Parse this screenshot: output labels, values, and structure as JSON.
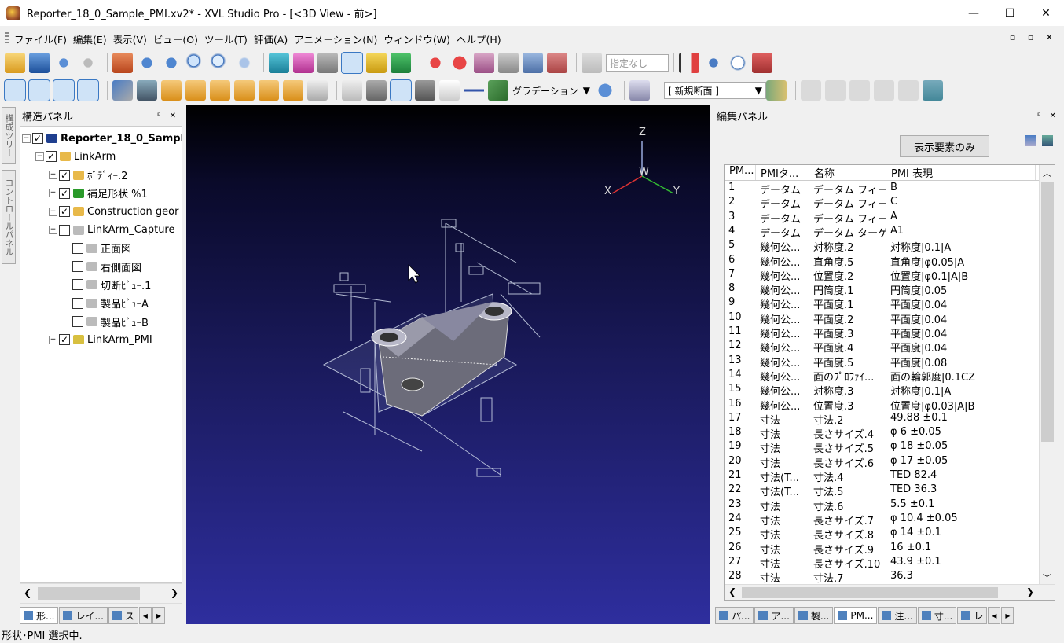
{
  "window": {
    "title": "Reporter_18_0_Sample_PMI.xv2* - XVL Studio Pro - [<3D View - 前>]",
    "minimize": "—",
    "maximize": "☐",
    "close": "✕"
  },
  "menu": [
    "ファイル(F)",
    "編集(E)",
    "表示(V)",
    "ビュー(O)",
    "ツール(T)",
    "評価(A)",
    "アニメーション(N)",
    "ウィンドウ(W)",
    "ヘルプ(H)"
  ],
  "mdi_controls": "▫ ▫ ✕",
  "toolbar": {
    "specify_dropdown": "指定なし",
    "gradation_label": "グラデーション",
    "section_dropdown": "[ 新規断面 ]"
  },
  "structure_panel": {
    "title": "構造パネル",
    "pin": "ᵖ ✕",
    "side_tabs": [
      "構成ツリー",
      "コントロールパネル"
    ],
    "tree": [
      {
        "label": "Reporter_18_0_Sample",
        "level": 0,
        "checked": true,
        "expander": "−",
        "bold": true
      },
      {
        "label": "LinkArm",
        "level": 1,
        "checked": true,
        "expander": "−"
      },
      {
        "label": "ﾎﾞﾃﾞｨｰ.2",
        "level": 2,
        "checked": true,
        "expander": "+"
      },
      {
        "label": "補足形状 %1",
        "level": 2,
        "checked": true,
        "expander": "+"
      },
      {
        "label": "Construction geor",
        "level": 2,
        "checked": true,
        "expander": "+"
      },
      {
        "label": "LinkArm_Capture",
        "level": 2,
        "checked": false,
        "expander": "−"
      },
      {
        "label": "正面図",
        "level": 3,
        "checked": false,
        "expander": ""
      },
      {
        "label": "右側面図",
        "level": 3,
        "checked": false,
        "expander": ""
      },
      {
        "label": "切断ﾋﾞｭｰ.1",
        "level": 3,
        "checked": false,
        "expander": ""
      },
      {
        "label": "製品ﾋﾞｭｰA",
        "level": 3,
        "checked": false,
        "expander": ""
      },
      {
        "label": "製品ﾋﾞｭｰB",
        "level": 3,
        "checked": false,
        "expander": ""
      },
      {
        "label": "LinkArm_PMI",
        "level": 2,
        "checked": true,
        "expander": "+"
      }
    ],
    "bottom_tabs": [
      "形...",
      "レイ...",
      "ス"
    ]
  },
  "view3d": {
    "axis_z": "Z",
    "axis_w": "W",
    "axis_x": "X",
    "axis_y": "Y"
  },
  "edit_panel": {
    "title": "編集パネル",
    "pin": "ᵖ ✕",
    "show_only_button": "表示要素のみ",
    "columns": [
      "PM...",
      "PMIタ...",
      "名称",
      "PMI 表現"
    ],
    "rows": [
      [
        "1",
        "データム",
        "データム フィーチ...",
        "B"
      ],
      [
        "2",
        "データム",
        "データム フィーチ...",
        "C"
      ],
      [
        "3",
        "データム",
        "データム フィーチ...",
        "A"
      ],
      [
        "4",
        "データム",
        "データム ターゲ...",
        "A1"
      ],
      [
        "5",
        "幾何公...",
        "対称度.2",
        "対称度|0.1|A"
      ],
      [
        "6",
        "幾何公...",
        "直角度.5",
        "直角度|φ0.05|A"
      ],
      [
        "7",
        "幾何公...",
        "位置度.2",
        "位置度|φ0.1|A|B"
      ],
      [
        "8",
        "幾何公...",
        "円筒度.1",
        "円筒度|0.05"
      ],
      [
        "9",
        "幾何公...",
        "平面度.1",
        "平面度|0.04"
      ],
      [
        "10",
        "幾何公...",
        "平面度.2",
        "平面度|0.04"
      ],
      [
        "11",
        "幾何公...",
        "平面度.3",
        "平面度|0.04"
      ],
      [
        "12",
        "幾何公...",
        "平面度.4",
        "平面度|0.04"
      ],
      [
        "13",
        "幾何公...",
        "平面度.5",
        "平面度|0.08"
      ],
      [
        "14",
        "幾何公...",
        "面のﾌﾟﾛﾌｧｲ...",
        "面の輪郭度|0.1CZ"
      ],
      [
        "15",
        "幾何公...",
        "対称度.3",
        "対称度|0.1|A"
      ],
      [
        "16",
        "幾何公...",
        "位置度.3",
        "位置度|φ0.03|A|B"
      ],
      [
        "17",
        "寸法",
        "寸法.2",
        "49.88 ±0.1"
      ],
      [
        "18",
        "寸法",
        "長さサイズ.4",
        "φ 6 ±0.05"
      ],
      [
        "19",
        "寸法",
        "長さサイズ.5",
        "φ 18 ±0.05"
      ],
      [
        "20",
        "寸法",
        "長さサイズ.6",
        "φ 17 ±0.05"
      ],
      [
        "21",
        "寸法(T...",
        "寸法.4",
        "TED 82.4"
      ],
      [
        "22",
        "寸法(T...",
        "寸法.5",
        "TED 36.3"
      ],
      [
        "23",
        "寸法",
        "寸法.6",
        "5.5 ±0.1"
      ],
      [
        "24",
        "寸法",
        "長さサイズ.7",
        "φ 10.4 ±0.05"
      ],
      [
        "25",
        "寸法",
        "長さサイズ.8",
        "φ 14 ±0.1"
      ],
      [
        "26",
        "寸法",
        "長さサイズ.9",
        "16 ±0.1"
      ],
      [
        "27",
        "寸法",
        "長さサイズ.10",
        "43.9 ±0.1"
      ],
      [
        "28",
        "寸法",
        "寸法.7",
        "36.3"
      ]
    ],
    "bottom_tabs": [
      "パ...",
      "ア...",
      "製...",
      "PM...",
      "注...",
      "寸...",
      "レ"
    ]
  },
  "status": "形状･PMI 選択中."
}
